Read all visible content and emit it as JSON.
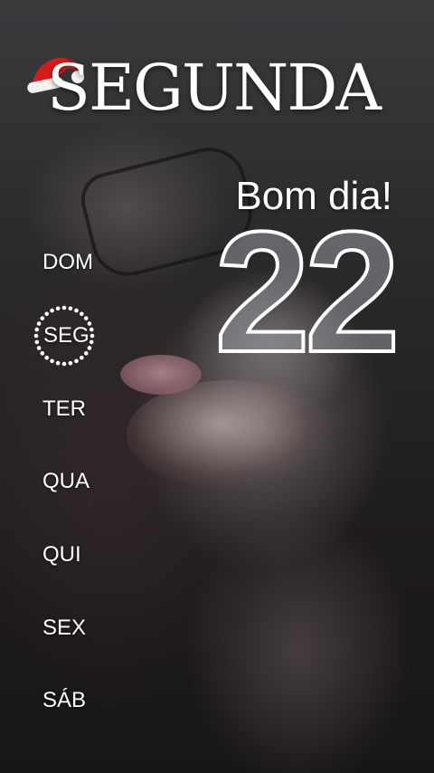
{
  "header": {
    "title": "SEGUNDA",
    "greeting": "Bom dia!",
    "day_number": "22"
  },
  "icons": {
    "hat": "santa-hat-icon",
    "ring": "dotted-ring-icon"
  },
  "colors": {
    "text": "#ffffff",
    "hat_red": "#d31d1d",
    "hat_white": "#f4f1ee"
  },
  "weekdays": [
    {
      "label": "DOM",
      "active": false
    },
    {
      "label": "SEG",
      "active": true
    },
    {
      "label": "TER",
      "active": false
    },
    {
      "label": "QUA",
      "active": false
    },
    {
      "label": "QUI",
      "active": false
    },
    {
      "label": "SEX",
      "active": false
    },
    {
      "label": "SÁB",
      "active": false
    }
  ]
}
